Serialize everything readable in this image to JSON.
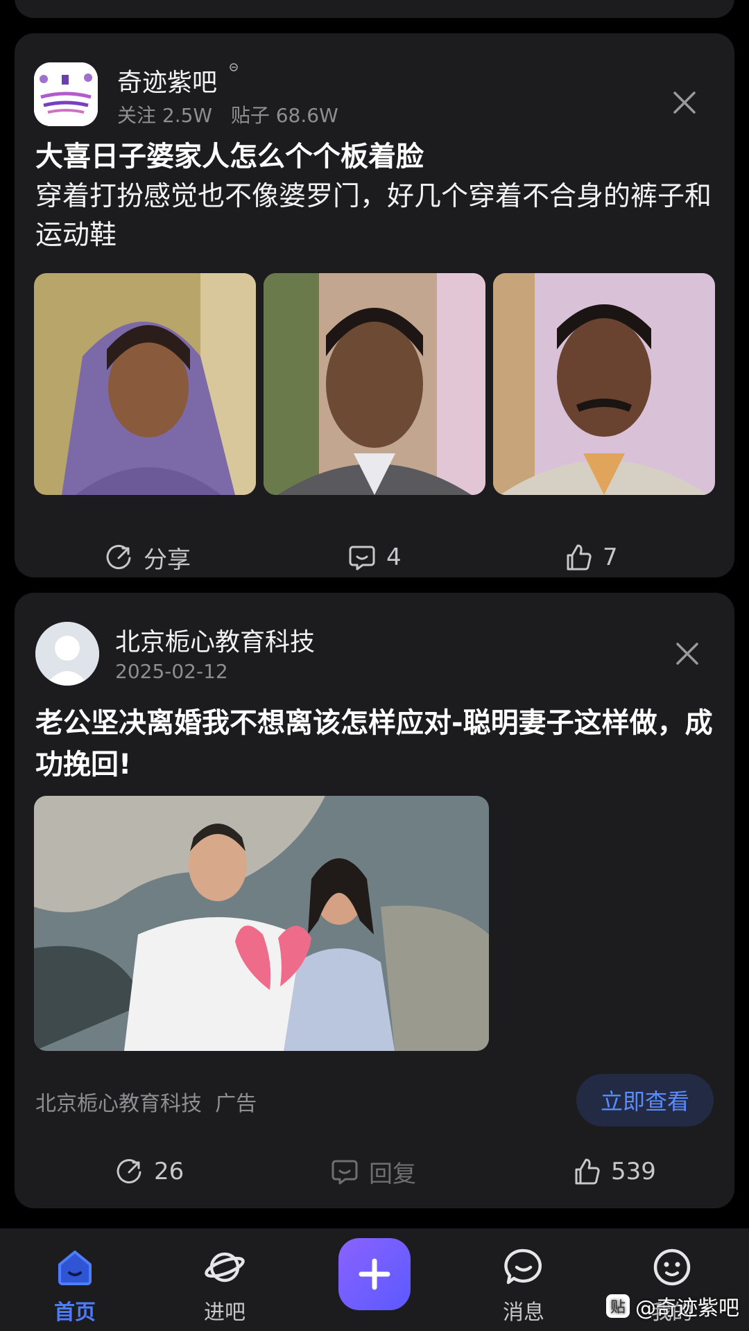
{
  "post1": {
    "author": "奇迹紫吧",
    "followers": "关注 2.5W",
    "posts": "贴子 68.6W",
    "title": "大喜日子婆家人怎么个个板着脸",
    "body": "穿着打扮感觉也不像婆罗门，好几个穿着不合身的裤子和运动鞋",
    "actions": {
      "share": "分享",
      "comments": "4",
      "likes": "7"
    }
  },
  "post2": {
    "author": "北京栀心教育科技",
    "date": "2025-02-12",
    "title": "老公坚决离婚我不想离该怎样应对-聪明妻子这样做，成功挽回!",
    "ad_source": "北京栀心教育科技",
    "ad_tag": "广告",
    "cta": "立即查看",
    "actions": {
      "share": "26",
      "reply": "回复",
      "likes": "539"
    }
  },
  "tabbar": {
    "home": "首页",
    "explore": "进吧",
    "messages": "消息",
    "mine": "我的"
  },
  "watermark": "@奇迹紫吧",
  "colors": {
    "accent": "#4e7cff",
    "card": "#1c1c1e",
    "fab": "#7b5cff"
  }
}
